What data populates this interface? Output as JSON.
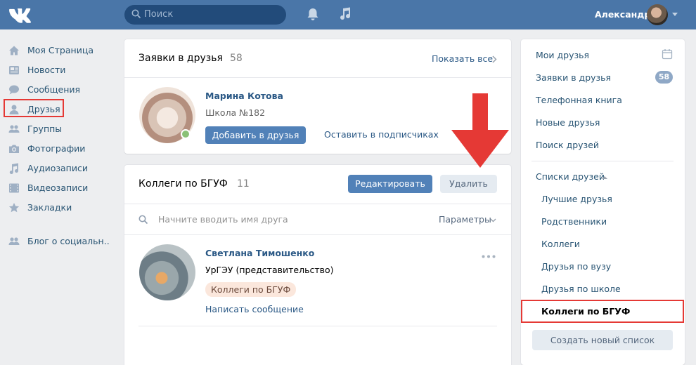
{
  "header": {
    "search_placeholder": "Поиск",
    "user_name": "Александр",
    "brand_color": "#4a76a8"
  },
  "leftnav": {
    "items": [
      {
        "label": "Моя Страница",
        "icon": "home-icon"
      },
      {
        "label": "Новости",
        "icon": "news-icon"
      },
      {
        "label": "Сообщения",
        "icon": "messages-icon"
      },
      {
        "label": "Друзья",
        "icon": "friends-icon",
        "active": true
      },
      {
        "label": "Группы",
        "icon": "groups-icon"
      },
      {
        "label": "Фотографии",
        "icon": "camera-icon"
      },
      {
        "label": "Аудиозаписи",
        "icon": "music-icon"
      },
      {
        "label": "Видеозаписи",
        "icon": "video-icon"
      },
      {
        "label": "Закладки",
        "icon": "star-icon"
      }
    ],
    "extra": {
      "label": "Блог о социальн..",
      "icon": "people-icon"
    }
  },
  "requests": {
    "title": "Заявки в друзья",
    "count": "58",
    "show_all": "Показать все",
    "person": {
      "name": "Марина Котова",
      "school": "Школа №182",
      "add_button": "Добавить в друзья",
      "keep_button": "Оставить в подписчиках"
    }
  },
  "list": {
    "title": "Коллеги по БГУФ",
    "count": "11",
    "edit_button": "Редактировать",
    "delete_button": "Удалить",
    "search_placeholder": "Начните вводить имя друга",
    "params": "Параметры",
    "friend": {
      "name": "Светлана Тимошенко",
      "univ": "УрГЭУ (представительство)",
      "tag": "Коллеги по БГУФ",
      "write": "Написать сообщение"
    }
  },
  "rightnav": {
    "items": [
      "Мои друзья",
      "Заявки в друзья",
      "Телефонная книга",
      "Новые друзья",
      "Поиск друзей"
    ],
    "requests_badge": "58",
    "lists_header": "Списки друзей",
    "lists": [
      "Лучшие друзья",
      "Родственники",
      "Коллеги",
      "Друзья по вузу",
      "Друзья по школе",
      "Коллеги по БГУФ"
    ],
    "create_button": "Создать новый список"
  },
  "annotation_color": "#e53935"
}
